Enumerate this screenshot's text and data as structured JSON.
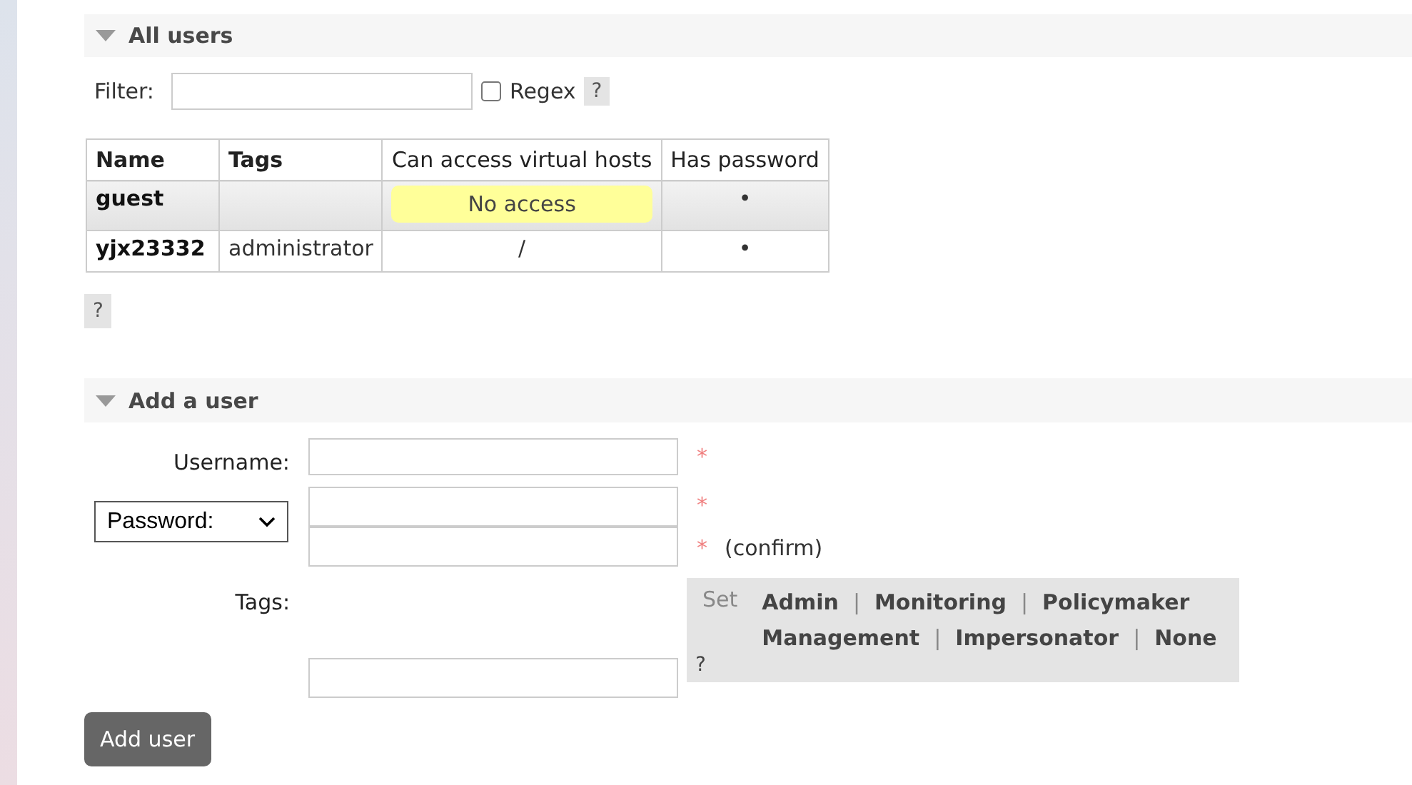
{
  "all_users": {
    "title": "All users",
    "expanded": true,
    "filter": {
      "label": "Filter:"
    },
    "regex": {
      "label": "Regex",
      "checked": false
    },
    "regex_help": "?",
    "table": {
      "columns": [
        "Name",
        "Tags",
        "Can access virtual hosts",
        "Has password"
      ],
      "rows": [
        {
          "name": "guest",
          "vhosts": "No access",
          "kind": "warning",
          "password": "•",
          "highlighted": true
        },
        {
          "name": "yjx23332",
          "tags": "administrator",
          "vhosts": "/",
          "kind": "plain",
          "password": "•",
          "highlighted": false
        }
      ]
    },
    "help": "?"
  },
  "add_user": {
    "title": "Add a user",
    "expanded": true,
    "username": {
      "label": "Username:",
      "required": "*"
    },
    "password": {
      "select": "Password:",
      "required": "*",
      "confirm_required": "*",
      "confirm": "(confirm)"
    },
    "tags": {
      "label": "Tags:",
      "set": "Set",
      "separator": "|",
      "lines": [
        [
          "Admin",
          "Monitoring",
          "Policymaker"
        ],
        [
          "Management",
          "Impersonator",
          "None"
        ]
      ],
      "help": "?"
    },
    "submit": "Add user"
  }
}
